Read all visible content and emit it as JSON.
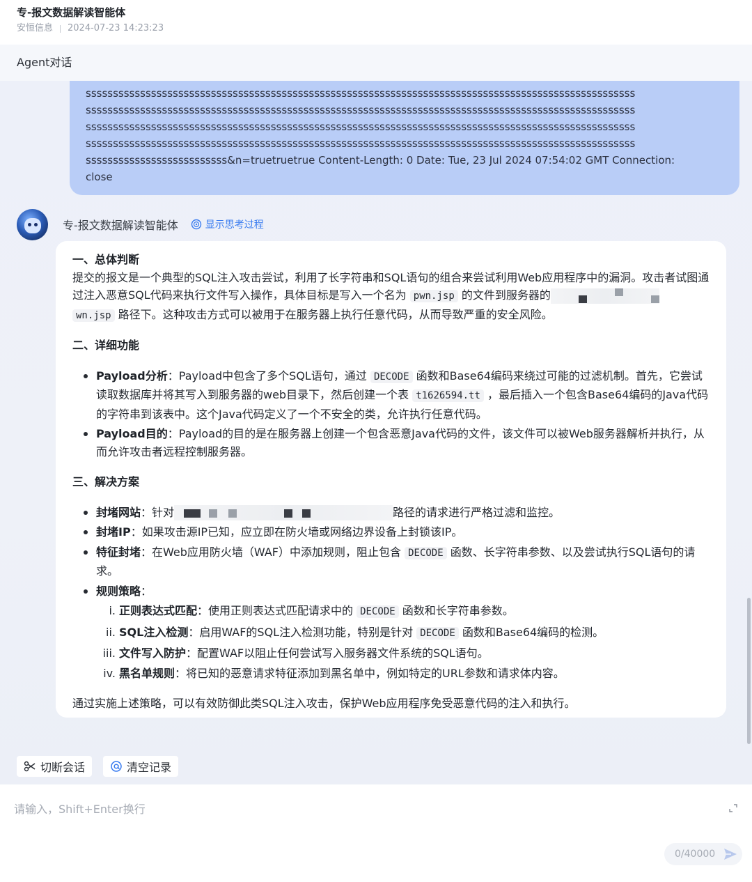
{
  "header": {
    "title": "专-报文数据解读智能体",
    "org": "安恒信息",
    "timestamp": "2024-07-23 14:23:23"
  },
  "panel": {
    "title": "Agent对话"
  },
  "user_message": {
    "lines": [
      "sssssssssssssssssssssssssssssssssssssssssssssssssssssssssssssssssssssssssssssssssssssssssssssssssssss",
      "sssssssssssssssssssssssssssssssssssssssssssssssssssssssssssssssssssssssssssssssssssssssssssssssssssss",
      "sssssssssssssssssssssssssssssssssssssssssssssssssssssssssssssssssssssssssssssssssssssssssssssssssssss",
      "sssssssssssssssssssssssssssssssssssssssssssssssssssssssssssssssssssssssssssssssssssssssssssssssssssss",
      "ssssssssssssssssssssssssss&n=truetruetrue Content-Length: 0 Date: Tue, 23 Jul 2024 07:54:02 GMT Connection:",
      "close"
    ]
  },
  "agent": {
    "name": "专-报文数据解读智能体",
    "think_toggle": "显示思考过程"
  },
  "answer": {
    "s1_title": "一、总体判断",
    "s1_p_a": "提交的报文是一个典型的SQL注入攻击尝试，利用了长字符串和SQL语句的组合来尝试利用Web应用程序中的漏洞。攻击者试图通过注入恶意SQL代码来执行文件写入操作，具体目标是写入一个名为",
    "s1_code1": "pwn.jsp",
    "s1_p_b": "的文件到服务器的",
    "s1_code2": "wn.jsp",
    "s1_p_c": "路径下。这种攻击方式可以被用于在服务器上执行任意代码，从而导致严重的安全风险。",
    "s2_title": "二、详细功能",
    "s2_i1_label": "Payload分析",
    "s2_i1_a": "：Payload中包含了多个SQL语句，通过",
    "s2_i1_code1": "DECODE",
    "s2_i1_b": "函数和Base64编码来绕过可能的过滤机制。首先，它尝试读取数据库并将其写入到服务器的web目录下，然后创建一个表",
    "s2_i1_code2": "t1626594.tt",
    "s2_i1_c": "，最后插入一个包含Base64编码的Java代码的字符串到该表中。这个Java代码定义了一个不安全的类，允许执行任意代码。",
    "s2_i2_label": "Payload目的",
    "s2_i2_a": "：Payload的目的是在服务器上创建一个包含恶意Java代码的文件，该文件可以被Web服务器解析并执行，从而允许攻击者远程控制服务器。",
    "s3_title": "三、解决方案",
    "s3_i1_label": "封堵网站",
    "s3_i1_a": "：针对",
    "s3_i1_b": "路径的请求进行严格过滤和监控。",
    "s3_i2_label": "封堵IP",
    "s3_i2_a": "：如果攻击源IP已知，应立即在防火墙或网络边界设备上封锁该IP。",
    "s3_i3_label": "特征封堵",
    "s3_i3_a": "：在Web应用防火墙（WAF）中添加规则，阻止包含",
    "s3_i3_code": "DECODE",
    "s3_i3_b": "函数、长字符串参数、以及尝试执行SQL语句的请求。",
    "s3_i4_label": "规则策略",
    "s3_i4_a": "：",
    "rules": [
      {
        "num": "i.",
        "label": "正则表达式匹配",
        "a": "：使用正则表达式匹配请求中的",
        "code": "DECODE",
        "b": "函数和长字符串参数。"
      },
      {
        "num": "ii.",
        "label": "SQL注入检测",
        "a": "：启用WAF的SQL注入检测功能，特别是针对",
        "code": "DECODE",
        "b": "函数和Base64编码的检测。"
      },
      {
        "num": "iii.",
        "label": "文件写入防护",
        "a": "：配置WAF以阻止任何尝试写入服务器文件系统的SQL语句。"
      },
      {
        "num": "iv.",
        "label": "黑名单规则",
        "a": "：将已知的恶意请求特征添加到黑名单中，例如特定的URL参数和请求体内容。"
      }
    ],
    "closing": "通过实施上述策略，可以有效防御此类SQL注入攻击，保护Web应用程序免受恶意代码的注入和执行。"
  },
  "actions": {
    "cut_label": "切断会话",
    "clear_label": "清空记录"
  },
  "input": {
    "placeholder": "请输入，Shift+Enter换行",
    "counter": "0/40000"
  },
  "colors": {
    "accent": "#3a7cf0",
    "user_bubble": "#b9cdf7",
    "background": "#eef1f8"
  }
}
